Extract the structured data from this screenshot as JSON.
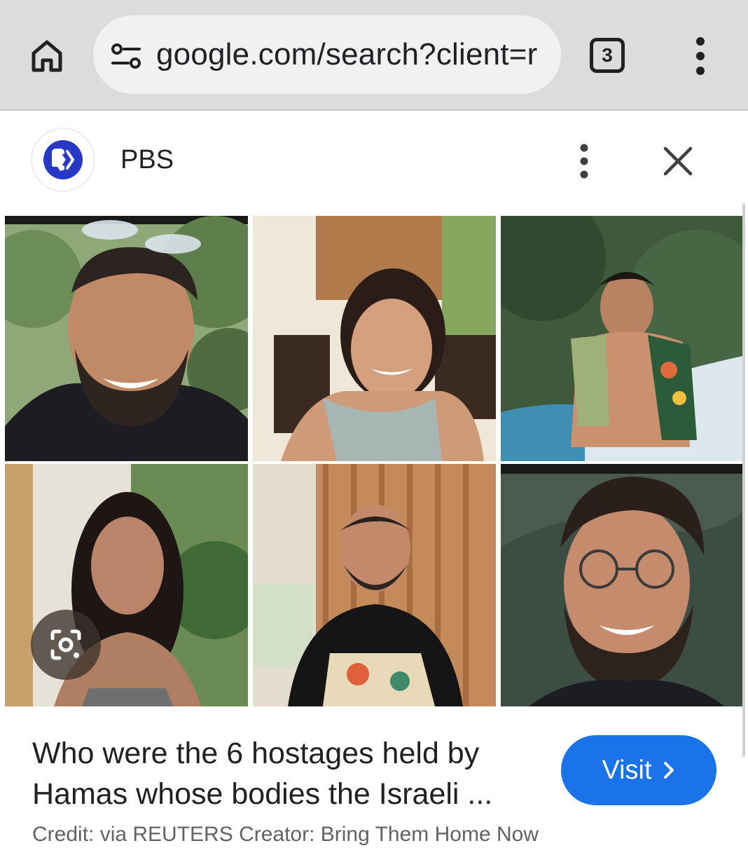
{
  "browser": {
    "url": "google.com/search?client=r",
    "tab_count": "3",
    "icons": {
      "home": "home-icon",
      "site_info": "tune-icon",
      "tabs": "tab-switcher-icon",
      "menu": "more-vert-icon"
    }
  },
  "source": {
    "name": "PBS",
    "logo": "pbs-logo",
    "icons": {
      "more": "more-vert-icon",
      "close": "close-icon"
    }
  },
  "collage": {
    "photos": [
      {
        "id": "photo-1",
        "description": "man-beard-sunglasses"
      },
      {
        "id": "photo-2",
        "description": "woman-curly-hair"
      },
      {
        "id": "photo-3",
        "description": "man-on-boat"
      },
      {
        "id": "photo-4",
        "description": "woman-long-hair"
      },
      {
        "id": "photo-5",
        "description": "man-apron"
      },
      {
        "id": "photo-6",
        "description": "man-glasses-beard"
      }
    ],
    "lens_icon": "google-lens-icon"
  },
  "result": {
    "headline": "Who were the 6 hostages held by Hamas whose bodies the Israeli ...",
    "visit_label": "Visit",
    "credit": "Credit: via REUTERS Creator: Bring Them Home Now"
  },
  "colors": {
    "accent": "#1a73e8",
    "topbar": "#dcdcdc",
    "omnibox": "#f1f1f1",
    "pbs_blue": "#2638c4"
  }
}
